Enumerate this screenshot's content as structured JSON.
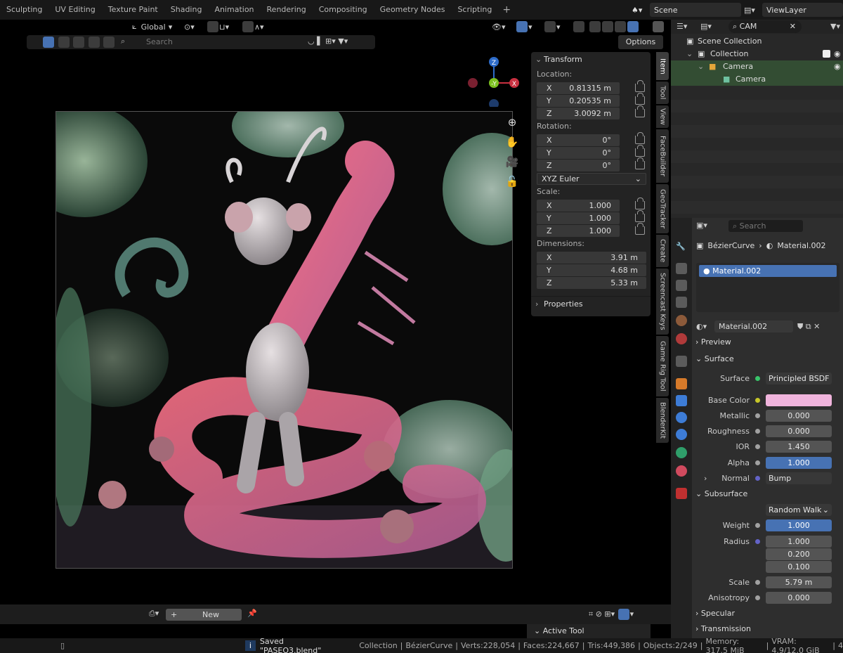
{
  "workspaces": [
    "Sculpting",
    "UV Editing",
    "Texture Paint",
    "Shading",
    "Animation",
    "Rendering",
    "Compositing",
    "Geometry Nodes",
    "Scripting"
  ],
  "scene": {
    "name": "Scene",
    "view_layer": "ViewLayer"
  },
  "viewport": {
    "orientation": "Global",
    "search_placeholder": "Search",
    "options_label": "Options",
    "gizmo": {
      "z": "Z",
      "y": "-Y",
      "x": "X"
    }
  },
  "npanel": {
    "transform_title": "Transform",
    "location_label": "Location:",
    "location": [
      {
        "axis": "X",
        "value": "0.81315 m"
      },
      {
        "axis": "Y",
        "value": "0.20535 m"
      },
      {
        "axis": "Z",
        "value": "3.0092 m"
      }
    ],
    "rotation_label": "Rotation:",
    "rotation": [
      {
        "axis": "X",
        "value": "0°"
      },
      {
        "axis": "Y",
        "value": "0°"
      },
      {
        "axis": "Z",
        "value": "0°"
      }
    ],
    "rotation_mode": "XYZ Euler",
    "scale_label": "Scale:",
    "scale": [
      {
        "axis": "X",
        "value": "1.000"
      },
      {
        "axis": "Y",
        "value": "1.000"
      },
      {
        "axis": "Z",
        "value": "1.000"
      }
    ],
    "dimensions_label": "Dimensions:",
    "dimensions": [
      {
        "axis": "X",
        "value": "3.91 m"
      },
      {
        "axis": "Y",
        "value": "4.68 m"
      },
      {
        "axis": "Z",
        "value": "5.33 m"
      }
    ],
    "properties_title": "Properties"
  },
  "vtabs": [
    "Item",
    "Tool",
    "View",
    "FaceBuilder",
    "GeoTracker",
    "Create",
    "Screencast Keys",
    "Game Rig Tool",
    "BlenderKit"
  ],
  "outliner": {
    "search_value": "CAM",
    "rows": [
      "Scene Collection",
      "Collection",
      "Camera",
      "Camera"
    ]
  },
  "properties": {
    "search_placeholder": "Search",
    "breadcrumb_object": "BézierCurve",
    "breadcrumb_material": "Material.002",
    "slot_name": "Material.002",
    "material_name": "Material.002",
    "preview": "Preview",
    "surface_section": "Surface",
    "surface_label": "Surface",
    "surface_value": "Principled BSDF",
    "rows": [
      {
        "label": "Base Color",
        "value": ""
      },
      {
        "label": "Metallic",
        "value": "0.000"
      },
      {
        "label": "Roughness",
        "value": "0.000"
      },
      {
        "label": "IOR",
        "value": "1.450"
      },
      {
        "label": "Alpha",
        "value": "1.000"
      }
    ],
    "normal_label": "Normal",
    "normal_value": "Bump",
    "subsurface_label": "Subsurface",
    "subsurface_method": "Random Walk",
    "weight_label": "Weight",
    "weight": "1.000",
    "radius_label": "Radius",
    "radius": [
      "1.000",
      "0.200",
      "0.100"
    ],
    "scale_label": "Scale",
    "scale": "5.79 m",
    "anisotropy_label": "Anisotropy",
    "anisotropy": "0.000",
    "specular": "Specular",
    "transmission": "Transmission",
    "base_color_hex": "#f0b4dc"
  },
  "bottom": {
    "new_label": "New",
    "active_tool": "Active Tool"
  },
  "status": {
    "message": "Saved \"PASEO3.blend\"",
    "collection": "Collection",
    "object": "BézierCurve",
    "verts": "Verts:228,054",
    "faces": "Faces:224,667",
    "tris": "Tris:449,386",
    "objects": "Objects:2/249",
    "memory": "Memory: 317.5 MiB",
    "vram": "VRAM: 4.9/12.0 GiB",
    "extra": "4"
  }
}
